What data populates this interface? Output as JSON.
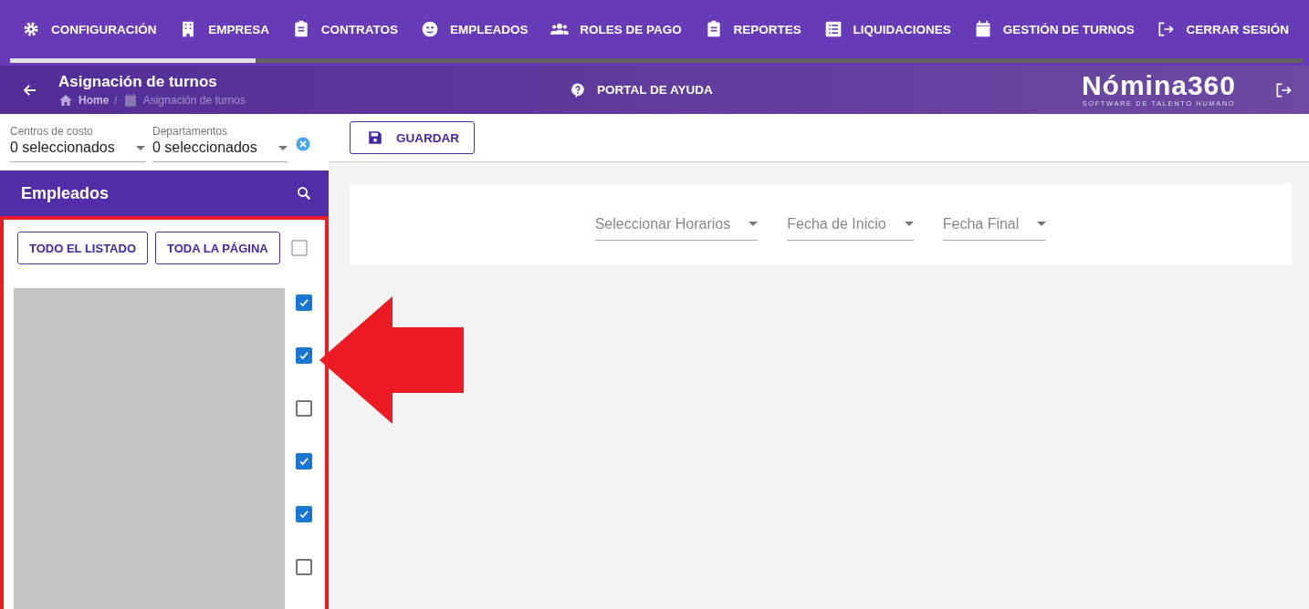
{
  "nav": [
    {
      "label": "CONFIGURACIÓN"
    },
    {
      "label": "EMPRESA"
    },
    {
      "label": "CONTRATOS"
    },
    {
      "label": "EMPLEADOS"
    },
    {
      "label": "ROLES DE PAGO"
    },
    {
      "label": "REPORTES"
    },
    {
      "label": "LIQUIDACIONES"
    },
    {
      "label": "GESTIÓN DE TURNOS"
    },
    {
      "label": "CERRAR SESIÓN"
    }
  ],
  "progress": {
    "level": 0.19
  },
  "header": {
    "title": "Asignación de turnos",
    "breadcrumb": [
      "Home",
      "Asignación de turnos"
    ],
    "breadcrumb_separator": "/",
    "help": "PORTAL DE AYUDA",
    "logo": "Nómina360",
    "logo_tagline": "SOFTWARE DE TALENTO HUMANO"
  },
  "filters": [
    {
      "label": "Centros de costo",
      "value": "0 seleccionados"
    },
    {
      "label": "Departamentos",
      "value": "0 seleccionados"
    }
  ],
  "employees": {
    "title": "Empleados",
    "buttons": [
      "TODO EL LISTADO",
      "TODA LA PÁGINA"
    ],
    "select_all": {
      "checked": false
    },
    "rows": [
      {
        "checked": true
      },
      {
        "checked": true
      },
      {
        "checked": false
      },
      {
        "checked": true
      },
      {
        "checked": true
      },
      {
        "checked": false
      }
    ]
  },
  "toolbar": {
    "save": "GUARDAR"
  },
  "selects": [
    {
      "placeholder": "Seleccionar Horarios"
    },
    {
      "placeholder": "Fecha de Inicio"
    },
    {
      "placeholder": "Fecha Final"
    }
  ]
}
